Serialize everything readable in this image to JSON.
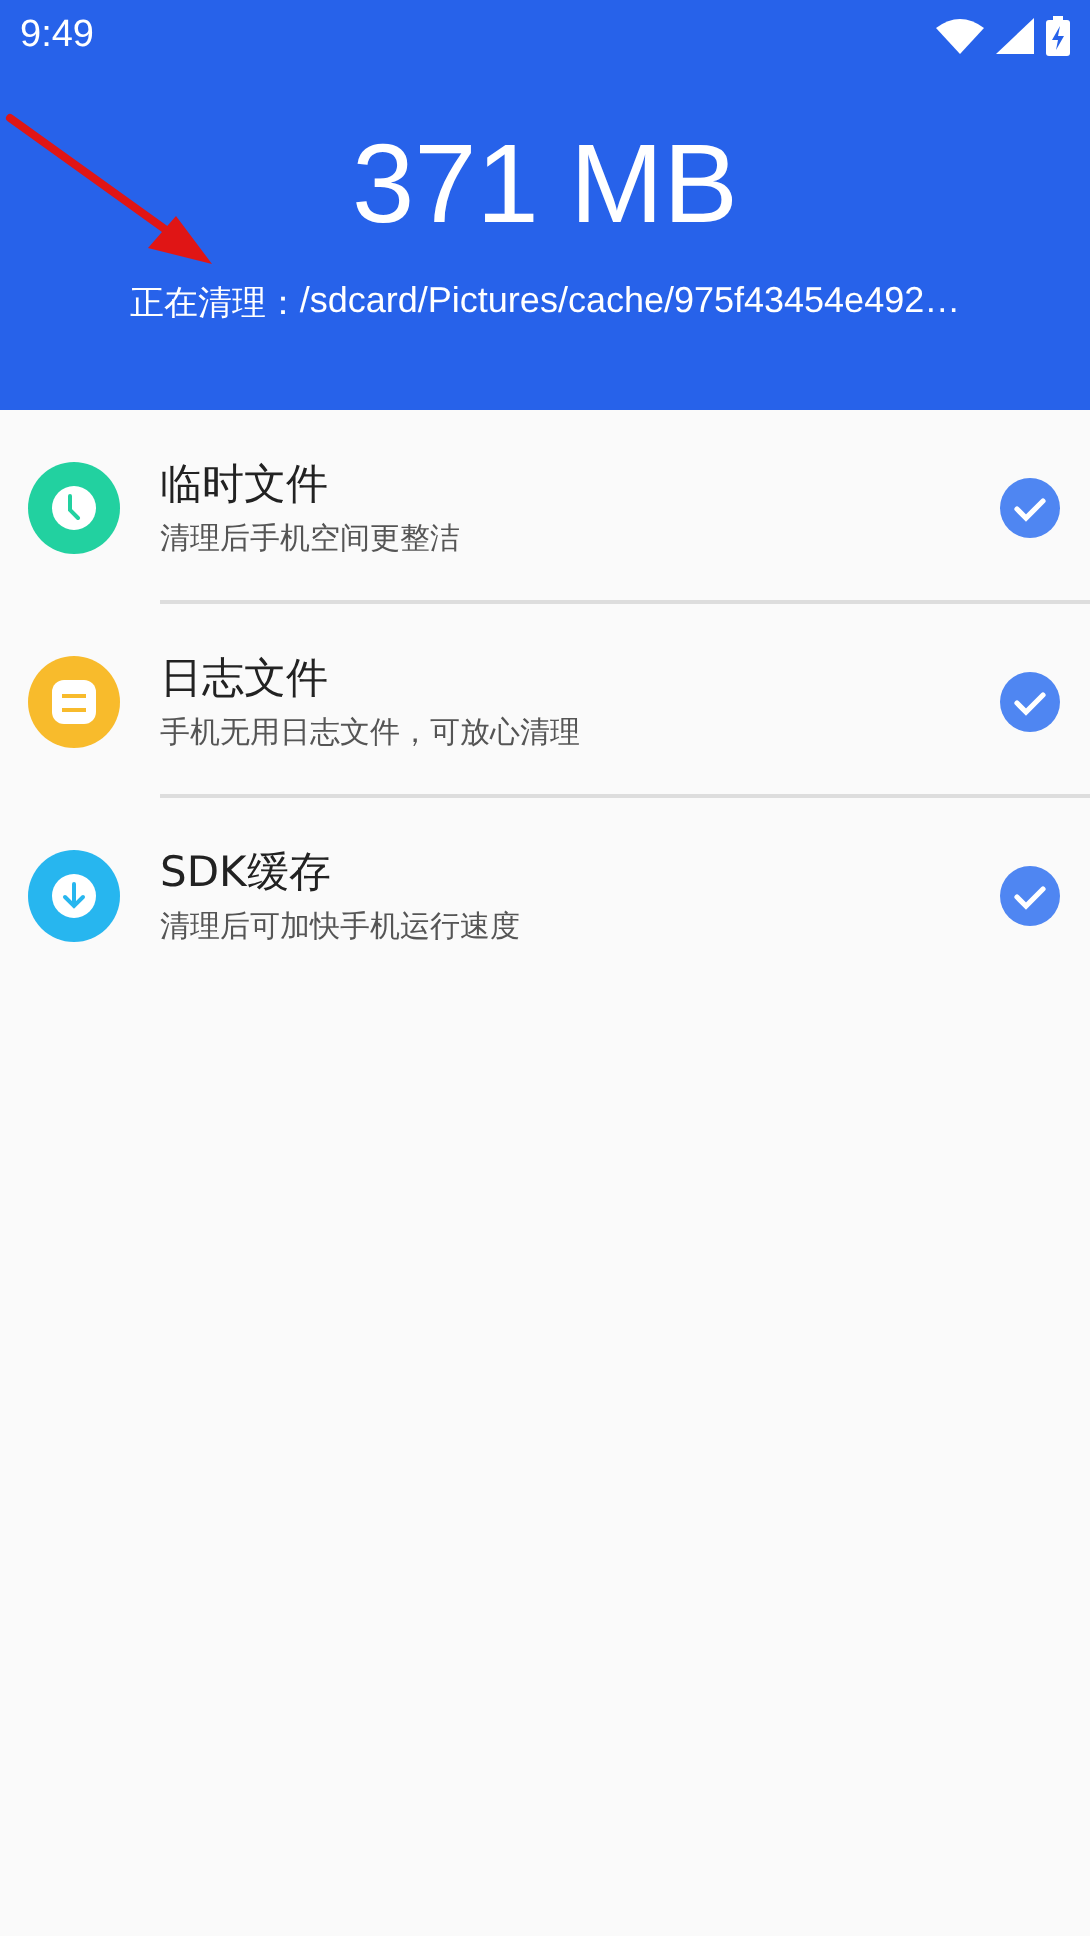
{
  "status_bar": {
    "time": "9:49"
  },
  "header": {
    "size": "371 MB",
    "cleaning_label": "正在清理：",
    "cleaning_path": "/sdcard/Pictures/cache/975f43454e492…"
  },
  "items": [
    {
      "kind": "clock",
      "color": "#22d1a0",
      "title": "临时文件",
      "subtitle": "清理后手机空间更整洁",
      "checked": true
    },
    {
      "kind": "note",
      "color": "#f8bb2c",
      "title": "日志文件",
      "subtitle": "手机无用日志文件，可放心清理",
      "checked": true
    },
    {
      "kind": "download",
      "color": "#27b6ef",
      "title": "SDK缓存",
      "subtitle": "清理后可加快手机运行速度",
      "checked": true
    }
  ]
}
